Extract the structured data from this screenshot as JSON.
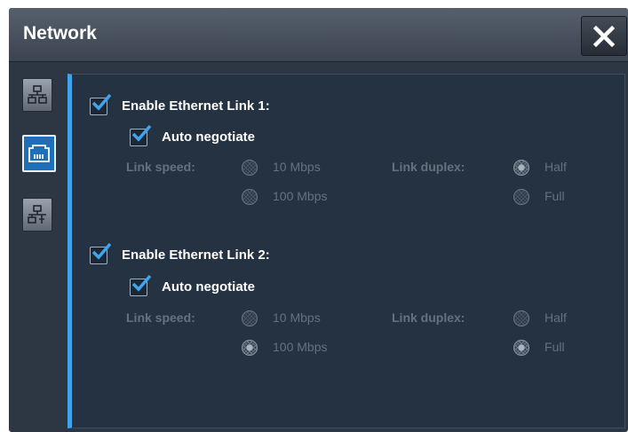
{
  "dialog": {
    "title": "Network"
  },
  "tabs": [
    {
      "name": "network-topology"
    },
    {
      "name": "ethernet-port",
      "active": true
    },
    {
      "name": "network-settings"
    }
  ],
  "link1": {
    "enable_label": "Enable Ethernet Link 1:",
    "enabled": true,
    "auto_label": "Auto negotiate",
    "auto": true,
    "speed_label": "Link speed:",
    "speed_options": [
      "10 Mbps",
      "100 Mbps"
    ],
    "speed_selected": "none",
    "duplex_label": "Link duplex:",
    "duplex_options": [
      "Half",
      "Full"
    ],
    "duplex_selected": "Half"
  },
  "link2": {
    "enable_label": "Enable Ethernet Link 2:",
    "enabled": true,
    "auto_label": "Auto negotiate",
    "auto": true,
    "speed_label": "Link speed:",
    "speed_options": [
      "10 Mbps",
      "100 Mbps"
    ],
    "speed_selected": "100 Mbps",
    "duplex_label": "Link duplex:",
    "duplex_options": [
      "Half",
      "Full"
    ],
    "duplex_selected": "Full"
  },
  "colors": {
    "accent": "#3fa4ec",
    "panel_bg": "#253242",
    "disabled_text": "#66717d"
  }
}
